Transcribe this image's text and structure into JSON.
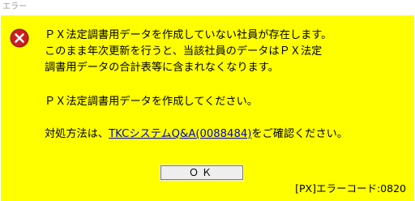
{
  "window": {
    "title": "エラー"
  },
  "icon": {
    "name": "error-icon",
    "color": "#cc1f1f"
  },
  "message": {
    "line1": "ＰＸ法定調書用データを作成していない社員が存在します。",
    "line2": "このまま年次更新を行うと、当該社員のデータはＰＸ法定",
    "line3": "調書用データの合計表等に含まれなくなります。",
    "line4": "ＰＸ法定調書用データを作成してください。",
    "line5_prefix": "対処方法は、",
    "line5_link": "TKCシステムQ&A(0088484)",
    "line5_suffix": "をご確認ください。"
  },
  "buttons": {
    "ok_label": "ＯＫ"
  },
  "footer": {
    "error_code": "[PX]エラーコード:0820"
  },
  "colors": {
    "background": "#ffff00",
    "link": "#0000cc"
  }
}
